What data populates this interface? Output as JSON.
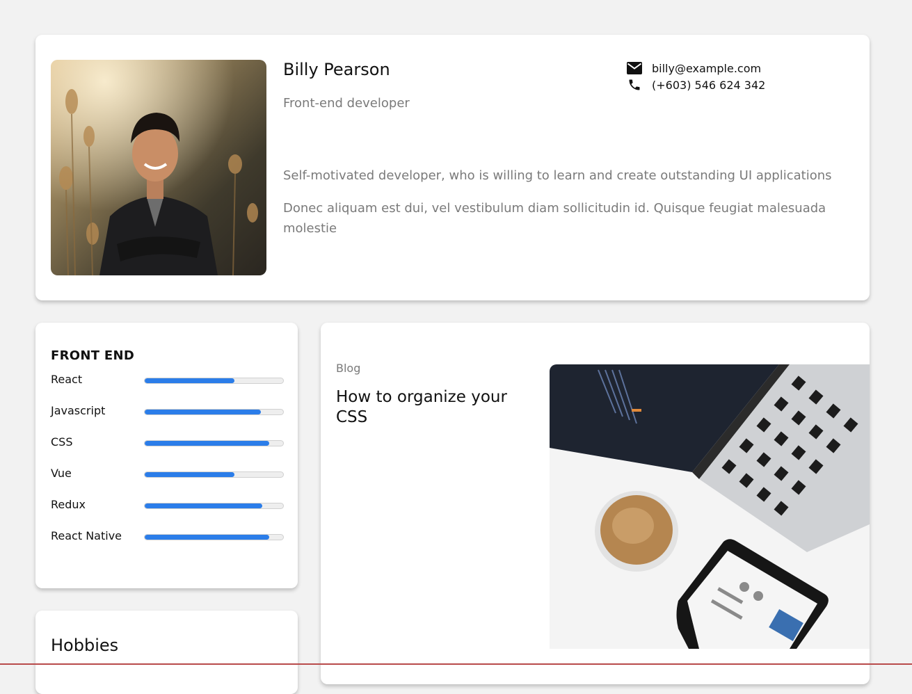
{
  "profile": {
    "name": "Billy Pearson",
    "role": "Front-end developer",
    "email": "billy@example.com",
    "phone": "(+603) 546 624 342",
    "about": [
      "Self-motivated developer, who is willing to learn and create outstanding UI applications",
      "Donec aliquam est dui, vel vestibulum diam sollicitudin id. Quisque feugiat malesuada molestie"
    ],
    "icons": {
      "email": "envelope-icon",
      "phone": "phone-icon"
    }
  },
  "skills": {
    "title": "FRONT END",
    "accent": "#2b7de9",
    "items": [
      {
        "name": "React",
        "level": 0.65
      },
      {
        "name": "Javascript",
        "level": 0.84
      },
      {
        "name": "CSS",
        "level": 0.9
      },
      {
        "name": "Vue",
        "level": 0.65
      },
      {
        "name": "Redux",
        "level": 0.85
      },
      {
        "name": "React Native",
        "level": 0.9
      }
    ]
  },
  "hobbies": {
    "title": "Hobbies"
  },
  "blog": {
    "category": "Blog",
    "title": "How to organize your CSS"
  }
}
